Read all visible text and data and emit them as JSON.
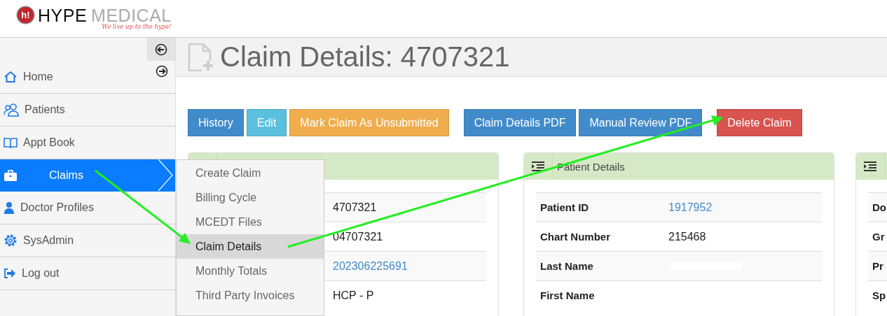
{
  "logo": {
    "badge": "h!",
    "word_1": "HYPE",
    "word_2": "MEDICAL",
    "tagline": "We live up to the hype!"
  },
  "sidebar": {
    "items": [
      {
        "label": "Home",
        "selected": false
      },
      {
        "label": "Patients",
        "selected": false
      },
      {
        "label": "Appt Book",
        "selected": false
      },
      {
        "label": "Claims",
        "selected": true
      },
      {
        "label": "Doctor Profiles",
        "selected": false
      },
      {
        "label": "SysAdmin",
        "selected": false
      },
      {
        "label": "Log out",
        "selected": false
      }
    ]
  },
  "submenu": {
    "items": [
      {
        "label": "Create Claim",
        "selected": false
      },
      {
        "label": "Billing Cycle",
        "selected": false
      },
      {
        "label": "MCEDT Files",
        "selected": false
      },
      {
        "label": "Claim Details",
        "selected": true
      },
      {
        "label": "Monthly Totals",
        "selected": false
      },
      {
        "label": "Third Party Invoices",
        "selected": false
      }
    ]
  },
  "page_title": "Claim Details: 4707321",
  "button_groups": [
    [
      {
        "label": "History",
        "kind": "primary"
      },
      {
        "label": "Edit",
        "kind": "info"
      },
      {
        "label": "Mark Claim As Unsubmitted",
        "kind": "warning"
      }
    ],
    [
      {
        "label": "Claim Details PDF",
        "kind": "primary"
      },
      {
        "label": "Manual Review PDF",
        "kind": "primary"
      }
    ],
    [
      {
        "label": "Delete Claim",
        "kind": "danger"
      }
    ]
  ],
  "panels": [
    {
      "rows": [
        {
          "value": "4707321"
        },
        {
          "value": "04707321"
        },
        {
          "value": "202306225691",
          "link": true
        },
        {
          "value": "HCP - P"
        }
      ]
    },
    {
      "title": "Patient Details",
      "rows": [
        {
          "label": "Patient ID",
          "value": "1917952",
          "link": true
        },
        {
          "label": "Chart Number",
          "value": "215468"
        },
        {
          "label": "Last Name",
          "redacted": true
        },
        {
          "label": "First Name"
        }
      ]
    },
    {
      "rows": [
        {
          "label": "Do"
        },
        {
          "label": "Gr"
        },
        {
          "label": "Pr"
        },
        {
          "label": "Sp"
        }
      ]
    }
  ]
}
